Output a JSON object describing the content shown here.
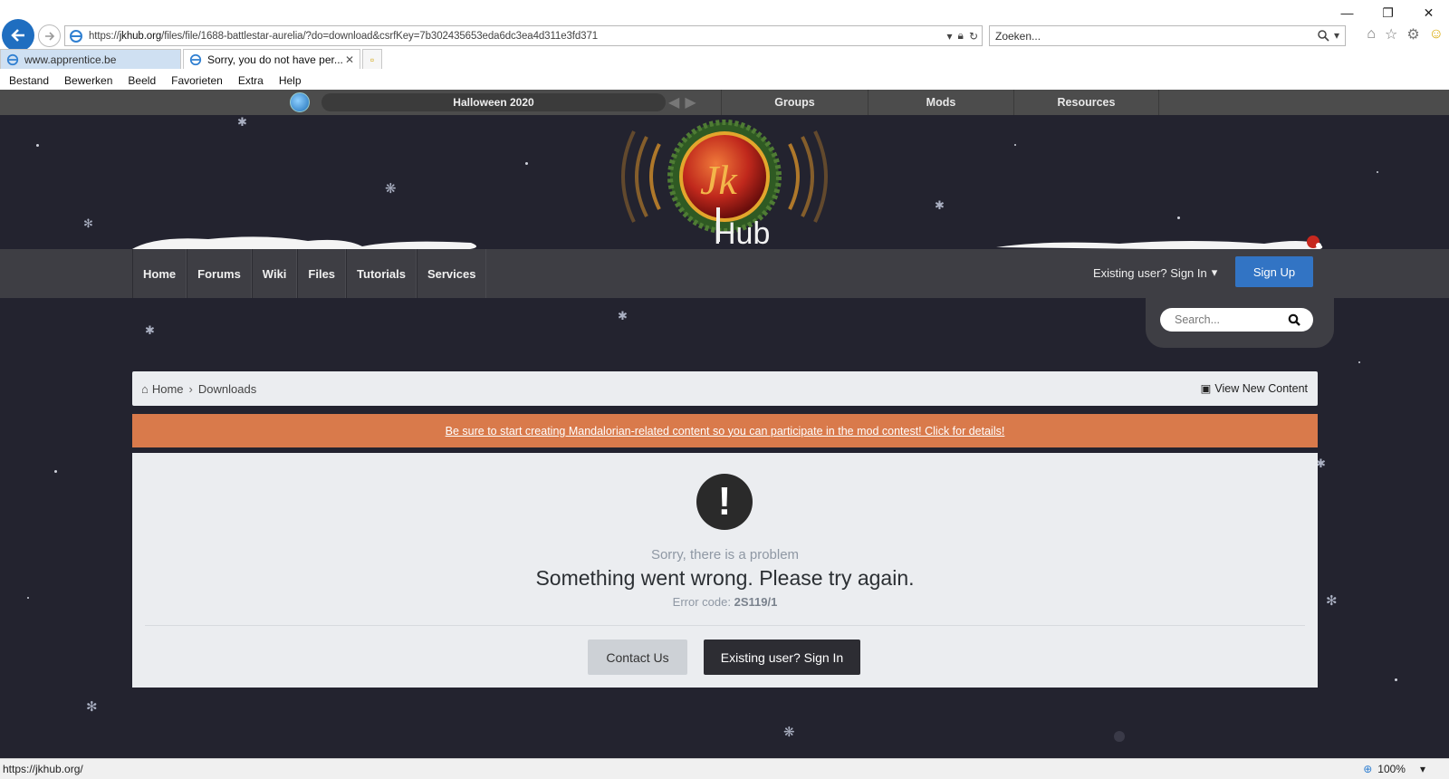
{
  "browser": {
    "url_prefix": "https://",
    "url_host": "jkhub.org",
    "url_path": "/files/file/1688-battlestar-aurelia/?do=download&csrfKey=7b302435653eda6dc3ea4d311e3fd371",
    "search_placeholder": "Zoeken...",
    "tabs": [
      {
        "label": "www.apprentice.be"
      },
      {
        "label": "Sorry, you do not have per..."
      }
    ],
    "menu": [
      "Bestand",
      "Bewerken",
      "Beeld",
      "Favorieten",
      "Extra",
      "Help"
    ],
    "status_url": "https://jkhub.org/",
    "zoom": "100%"
  },
  "site": {
    "topbar": {
      "slider_title": "Halloween 2020",
      "links": [
        "Groups",
        "Mods",
        "Resources"
      ]
    },
    "logo_text": "Hub",
    "nav": [
      "Home",
      "Forums",
      "Wiki",
      "Files",
      "Tutorials",
      "Services"
    ],
    "signin_label": "Existing user? Sign In",
    "signup_label": "Sign Up",
    "search_placeholder": "Search...",
    "breadcrumb": {
      "home": "Home",
      "current": "Downloads",
      "view_new": "View New Content"
    },
    "banner_text": "Be sure to start creating Mandalorian-related content so you can participate in the mod contest! Click for details!",
    "error": {
      "subtitle": "Sorry, there is a problem",
      "message": "Something went wrong. Please try again.",
      "code_label": "Error code:",
      "code": "2S119/1",
      "contact_label": "Contact Us",
      "signin_label": "Existing user? Sign In"
    }
  },
  "colors": {
    "page_bg": "#23232f",
    "accent_blue": "#3274c4",
    "banner_orange": "#d97a4b"
  }
}
